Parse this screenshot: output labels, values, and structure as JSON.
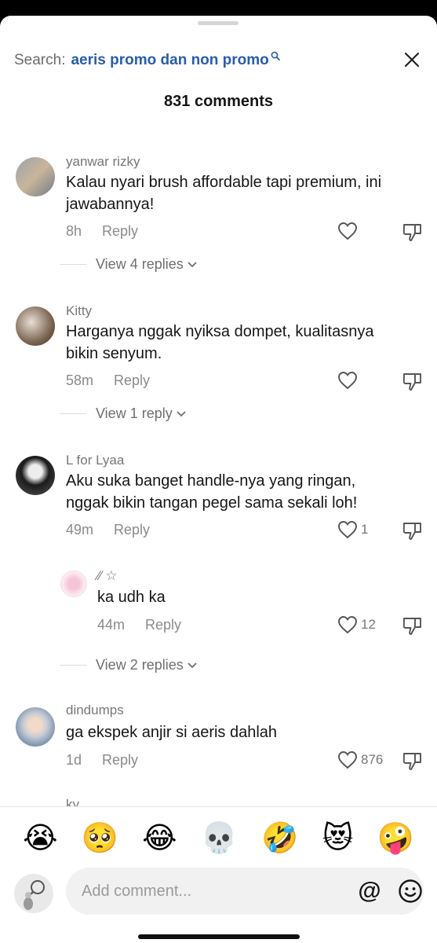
{
  "header": {
    "search_prefix": "Search:",
    "search_query": "aeris promo dan non promo",
    "comment_count": "831 comments"
  },
  "comments": [
    {
      "username": "yanwar rizky",
      "text_lines": [
        "Kalau nyari brush affordable tapi premium, ini",
        "jawabannya!"
      ],
      "time": "8h",
      "reply_label": "Reply",
      "likes": "",
      "view_replies": "View 4 replies"
    },
    {
      "username": "Kitty",
      "text_lines": [
        "Harganya nggak nyiksa dompet, kualitasnya",
        "bikin senyum."
      ],
      "time": "58m",
      "reply_label": "Reply",
      "likes": "",
      "view_replies": "View 1 reply"
    },
    {
      "username": "L  for  Lyaa",
      "text_lines": [
        "Aku suka banget handle-nya yang ringan,",
        "nggak bikin tangan pegel sama sekali loh!"
      ],
      "time": "49m",
      "reply_label": "Reply",
      "likes": "1"
    },
    {
      "username": "dindumps",
      "text_lines": [
        "ga ekspek anjir si aeris dahlah"
      ],
      "time": "1d",
      "reply_label": "Reply",
      "likes": "876"
    }
  ],
  "nested_reply": {
    "username": "⁄⁄ ☆",
    "text": "ka udh ka",
    "time": "44m",
    "reply_label": "Reply",
    "likes": "12",
    "view_replies": "View 2 replies"
  },
  "partial_username": "ky",
  "emoji_bar": [
    "😭",
    "🥺",
    "😂",
    "💀",
    "🤣",
    "😻",
    "🤪"
  ],
  "composer": {
    "placeholder": "Add comment...",
    "mention_symbol": "@"
  },
  "colors": {
    "accent": "#2a5da8",
    "text": "#161616",
    "muted": "#8a8a8a"
  }
}
